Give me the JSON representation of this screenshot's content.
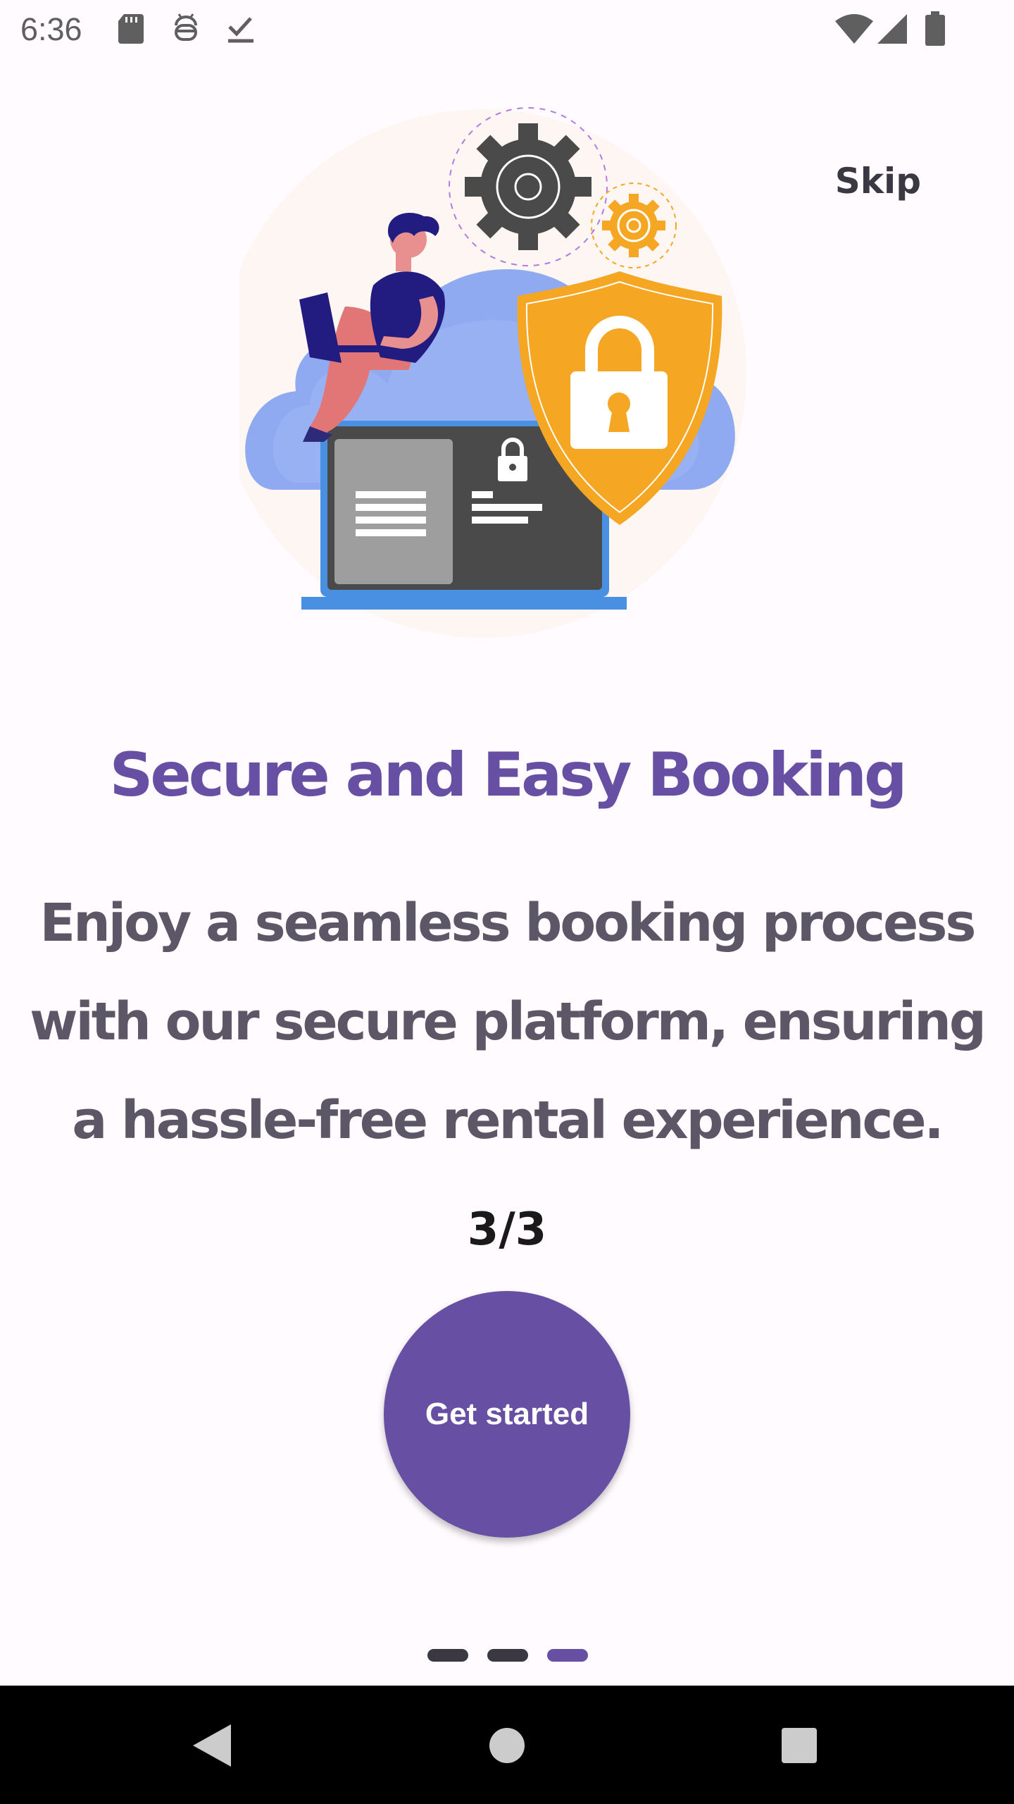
{
  "status_bar": {
    "time": "6:36",
    "icons": [
      "sd-card-icon",
      "android-debug-icon",
      "download-done-icon",
      "wifi-icon",
      "signal-icon",
      "battery-icon"
    ]
  },
  "onboarding": {
    "skip_label": "Skip",
    "title": "Secure and Easy Booking",
    "description_lines": [
      "Enjoy a seamless booking process",
      "with our secure platform, ensuring",
      "a hassle-free rental experience."
    ],
    "counter": "3/3",
    "cta_label": "Get started",
    "page_indicator": {
      "total": 3,
      "active": 3
    }
  },
  "nav_bar": {
    "buttons": [
      "back-icon",
      "home-icon",
      "recents-icon"
    ]
  },
  "colors": {
    "primary": "#6750A4",
    "text_dark": "#3A3842",
    "text_muted": "#5B5766",
    "shield": "#F5A623",
    "cloud": "#8FAAF0",
    "gear": "#4A4A4A"
  }
}
